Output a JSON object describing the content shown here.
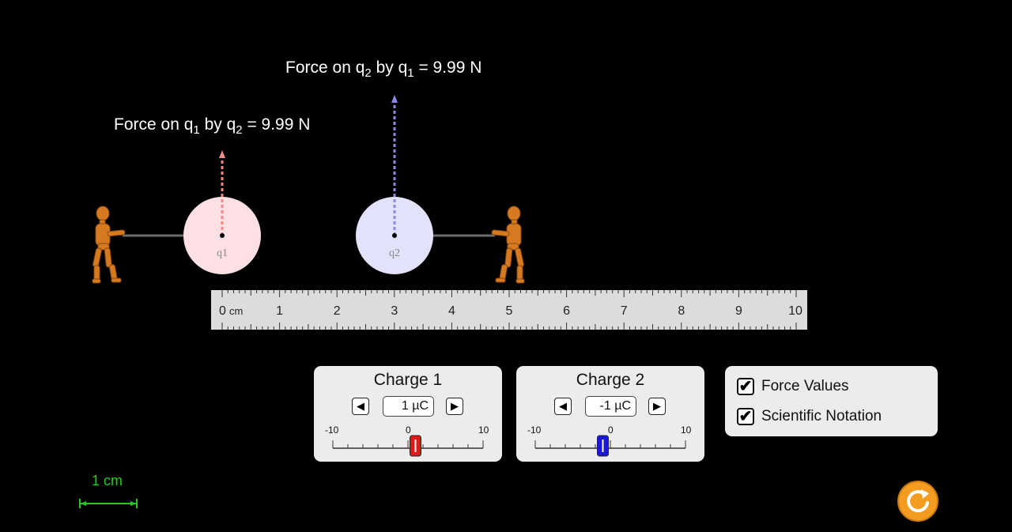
{
  "force_on_q1": {
    "prefix": "Force on q",
    "sub1": "1",
    "mid": " by q",
    "sub2": "2",
    "suffix": " = 9.99 N"
  },
  "force_on_q2": {
    "prefix": "Force on q",
    "sub1": "2",
    "mid": " by q",
    "sub2": "1",
    "suffix": " = 9.99 N"
  },
  "charges": {
    "q1": {
      "label": "q1",
      "color": "#fde0e4"
    },
    "q2": {
      "label": "q2",
      "color": "#e2e2fb"
    }
  },
  "ruler": {
    "unit": "cm",
    "ticks": [
      "0",
      "1",
      "2",
      "3",
      "4",
      "5",
      "6",
      "7",
      "8",
      "9",
      "10"
    ]
  },
  "charge1_panel": {
    "title": "Charge 1",
    "value": "1 µC",
    "min": "-10",
    "mid": "0",
    "max": "10",
    "slider_value": 1,
    "thumb_color": "#e01818"
  },
  "charge2_panel": {
    "title": "Charge 2",
    "value": "-1 µC",
    "min": "-10",
    "mid": "0",
    "max": "10",
    "slider_value": -1,
    "thumb_color": "#1a1ad6"
  },
  "options": {
    "force_values": {
      "label": "Force Values",
      "checked": true
    },
    "scientific_notation": {
      "label": "Scientific Notation",
      "checked": true
    }
  },
  "scale_bar": {
    "label": "1 cm"
  },
  "colors": {
    "force_q1": "#f08a8a",
    "force_q2": "#8a8ae8",
    "scale_bar": "#22cc22",
    "reset": "#f39c1f"
  }
}
